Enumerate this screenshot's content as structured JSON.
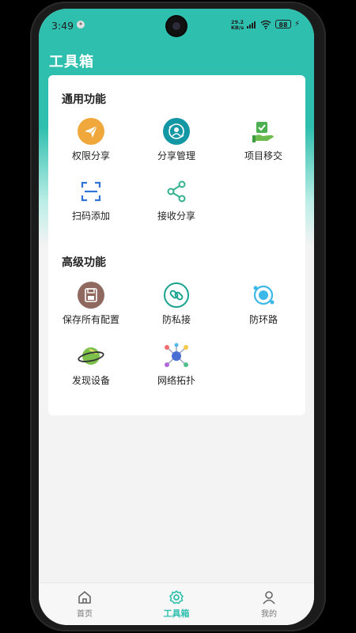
{
  "status": {
    "time": "3:49",
    "net_speed": "29.2",
    "net_unit": "KB/s",
    "signal": "5G",
    "battery": "88"
  },
  "app": {
    "title": "工具箱"
  },
  "sections": [
    {
      "title": "通用功能",
      "items": [
        {
          "label": "权限分享",
          "icon": "send-plane-icon",
          "color": "#f0a73c"
        },
        {
          "label": "分享管理",
          "icon": "share-manage-icon",
          "color": "#1497a5"
        },
        {
          "label": "项目移交",
          "icon": "project-transfer-icon",
          "color": "#4caf50"
        },
        {
          "label": "扫码添加",
          "icon": "scan-icon",
          "color": "#2f73d9"
        },
        {
          "label": "接收分享",
          "icon": "share-icon",
          "color": "#35b08f"
        }
      ]
    },
    {
      "title": "高级功能",
      "items": [
        {
          "label": "保存所有配置",
          "icon": "save-config-icon",
          "color": "#8f6960"
        },
        {
          "label": "防私接",
          "icon": "link-guard-icon",
          "color": "#1aa38f"
        },
        {
          "label": "防环路",
          "icon": "loop-guard-icon",
          "color": "#3bb8e8"
        },
        {
          "label": "发现设备",
          "icon": "planet-icon",
          "color": "#7cc04b"
        },
        {
          "label": "网络拓扑",
          "icon": "topology-icon",
          "color": "#4a6fd4"
        }
      ]
    }
  ],
  "tabs": [
    {
      "label": "首页",
      "icon": "home-icon",
      "active": false
    },
    {
      "label": "工具箱",
      "icon": "gear-icon",
      "active": true
    },
    {
      "label": "我的",
      "icon": "person-icon",
      "active": false
    }
  ]
}
